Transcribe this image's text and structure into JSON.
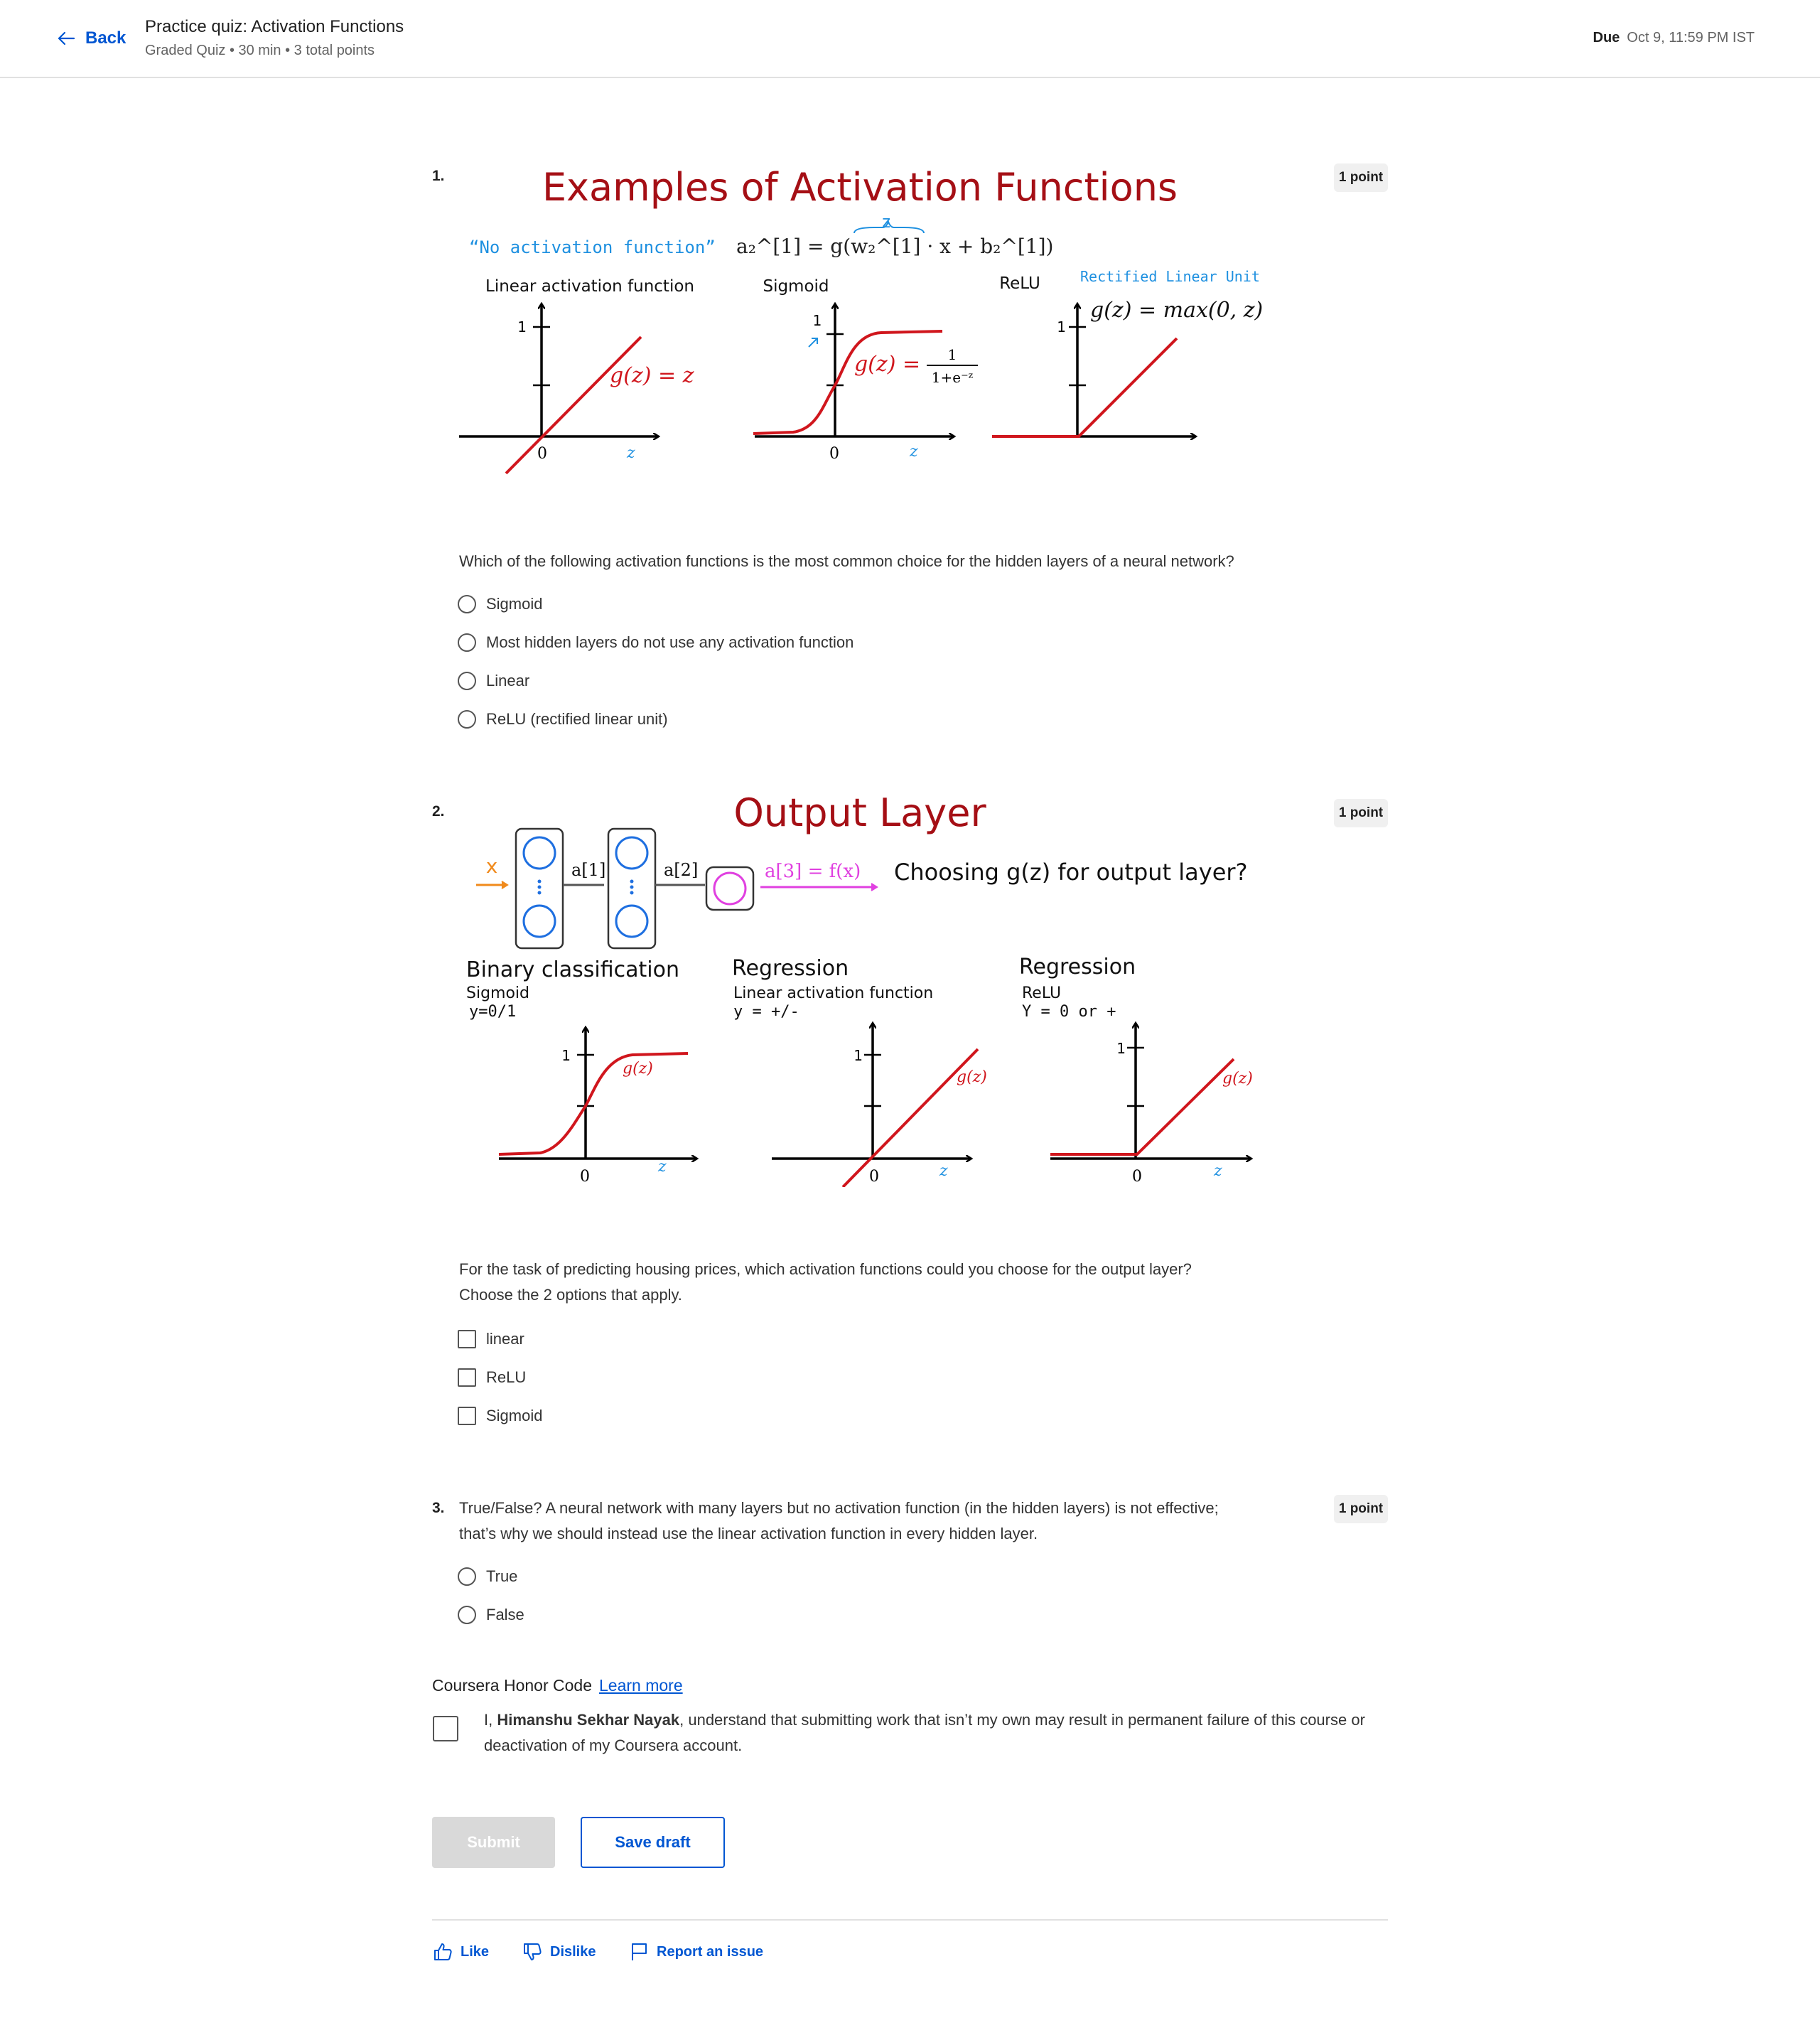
{
  "header": {
    "back_label": "Back",
    "quiz_title": "Practice quiz: Activation Functions",
    "quiz_meta": "Graded Quiz • 30 min • 3 total points",
    "due_label": "Due",
    "due_value": "Oct 9, 11:59 PM IST"
  },
  "q1": {
    "number": "1.",
    "points": "1 point",
    "figure": {
      "title": "Examples of Activation Functions",
      "note_no_activation": "“No activation function”",
      "formula_top": "a₂^[1] = g(w₂^[1] · x + b₂^[1])",
      "z_note": "z",
      "panel1_label": "Linear activation function",
      "panel2_label": "Sigmoid",
      "panel3_label": "ReLU",
      "relu_note": "Rectified Linear Unit",
      "g_linear": "g(z) = z",
      "g_sigmoid_lhs": "g(z) =",
      "g_sigmoid_num": "1",
      "g_sigmoid_den": "1+e⁻ᶻ",
      "g_relu": "g(z) = max(0, z)",
      "tick_one": "1",
      "tick_zero": "0",
      "axis_z": "z"
    },
    "prompt": "Which of the following activation functions is the most common choice for the hidden layers of a neural network?",
    "options": [
      "Sigmoid",
      "Most hidden layers do not use any activation function",
      "Linear",
      "ReLU (rectified linear unit)"
    ]
  },
  "q2": {
    "number": "2.",
    "points": "1 point",
    "figure": {
      "title": "Output Layer",
      "x_label": "x",
      "a1_label": "a[1]",
      "a2_label": "a[2]",
      "a3_eq": "a[3] = f(x)",
      "choosing": "Choosing g(z) for output layer?",
      "p1_title": "Binary classification",
      "p1_sub1": "Sigmoid",
      "p1_sub2": "y=0/1",
      "p2_title": "Regression",
      "p2_sub1": "Linear activation function",
      "p2_sub2": "y = +/-",
      "p3_title": "Regression",
      "p3_sub1": "ReLU",
      "p3_sub2": "Y = 0 or +",
      "gz": "g(z)",
      "tick_one": "1",
      "tick_zero": "0",
      "axis_z": "z"
    },
    "prompt_line1": "For the task of predicting housing prices, which activation functions could you choose for the output layer?",
    "prompt_line2": "Choose the 2 options that apply.",
    "options": [
      "linear",
      "ReLU",
      "Sigmoid"
    ]
  },
  "q3": {
    "number": "3.",
    "points": "1 point",
    "prompt_line1": "True/False? A neural network with many layers but no activation function (in the hidden layers) is not effective;",
    "prompt_line2": "that’s why we should instead use the linear activation function in every hidden layer.",
    "options": [
      "True",
      "False"
    ]
  },
  "honor": {
    "title": "Coursera Honor Code",
    "learn_more": "Learn more",
    "text_prefix": "I, ",
    "name": "Himanshu Sekhar Nayak",
    "text_suffix": ", understand that submitting work that isn’t my own may result in permanent failure of this course or deactivation of my Coursera account."
  },
  "actions": {
    "submit": "Submit",
    "save_draft": "Save draft"
  },
  "feedback": {
    "like": "Like",
    "dislike": "Dislike",
    "report": "Report an issue"
  },
  "colors": {
    "accent": "#0056d2",
    "figure_title": "#a50f15",
    "curve_red": "#d0161d",
    "note_blue": "#1e90e0"
  }
}
